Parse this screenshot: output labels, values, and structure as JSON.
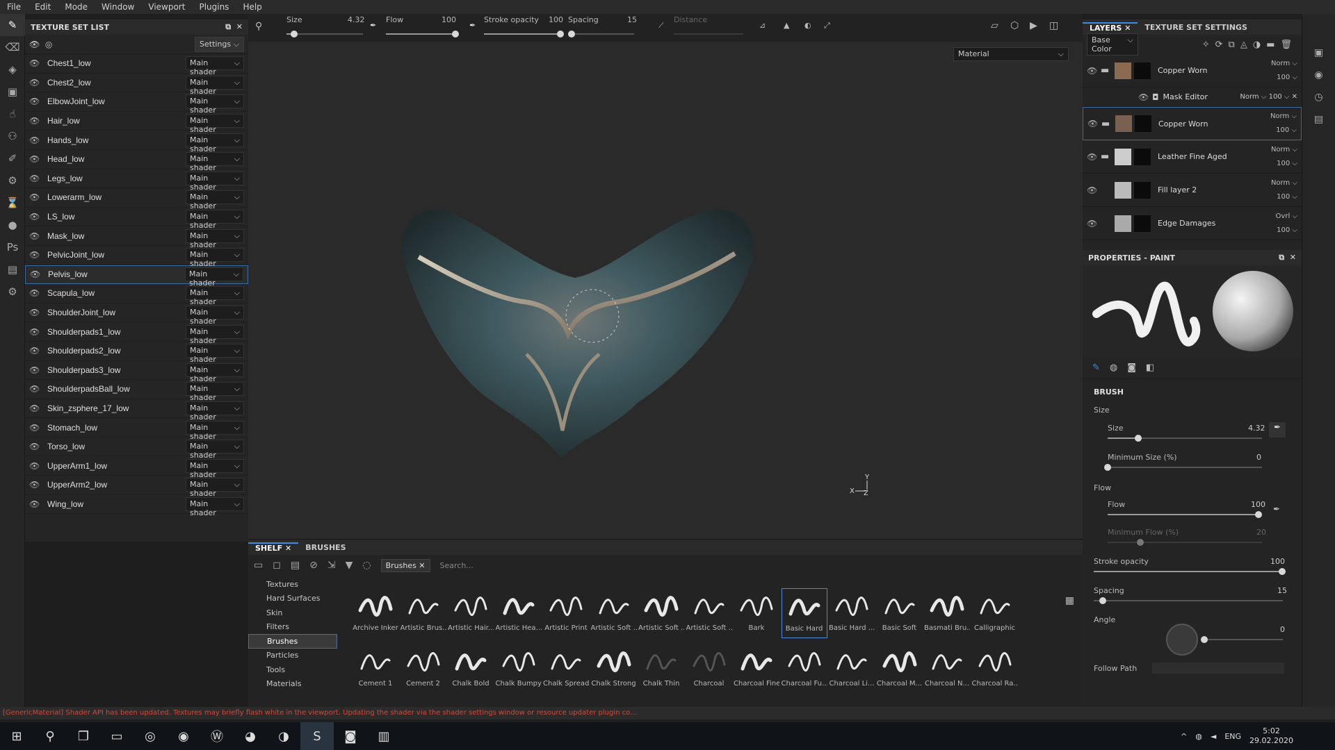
{
  "menu": [
    "File",
    "Edit",
    "Mode",
    "Window",
    "Viewport",
    "Plugins",
    "Help"
  ],
  "texture_set_list": {
    "title": "TEXTURE SET LIST",
    "settings_label": "Settings",
    "shader_label": "Main shader",
    "selected": "Pelvis_low",
    "items": [
      "Chest1_low",
      "Chest2_low",
      "ElbowJoint_low",
      "Hair_low",
      "Hands_low",
      "Head_low",
      "Legs_low",
      "Lowerarm_low",
      "LS_low",
      "Mask_low",
      "PelvicJoint_low",
      "Pelvis_low",
      "Scapula_low",
      "ShoulderJoint_low",
      "Shoulderpads1_low",
      "Shoulderpads2_low",
      "Shoulderpads3_low",
      "ShoulderpadsBall_low",
      "Skin_zsphere_17_low",
      "Stomach_low",
      "Torso_low",
      "UpperArm1_low",
      "UpperArm2_low",
      "Wing_low"
    ]
  },
  "tool_options": {
    "size_label": "Size",
    "size_value": "4.32",
    "size_pct": 0.1,
    "flow_label": "Flow",
    "flow_value": "100",
    "flow_pct": 1.0,
    "stroke_label": "Stroke opacity",
    "stroke_value": "100",
    "stroke_pct": 1.0,
    "spacing_label": "Spacing",
    "spacing_value": "15",
    "spacing_pct": 0.05,
    "distance_label": "Distance"
  },
  "viewport": {
    "material_mode": "Material"
  },
  "shelf": {
    "tabs": [
      "SHELF",
      "BRUSHES"
    ],
    "filter_chip": "Brushes",
    "search_placeholder": "Search...",
    "categories": [
      "Textures",
      "Hard Surfaces",
      "Skin",
      "Filters",
      "Brushes",
      "Particles",
      "Tools",
      "Materials"
    ],
    "selected_category": "Brushes",
    "brushes_row1": [
      "Archive Inker",
      "Artistic Brus...",
      "Artistic Hair...",
      "Artistic Hea...",
      "Artistic Print",
      "Artistic Soft ...",
      "Artistic Soft ...",
      "Artistic Soft ...",
      "Bark",
      "Basic Hard",
      "Basic Hard ...",
      "Basic Soft",
      "Basmati Bru...",
      "Calligraphic"
    ],
    "brushes_row2": [
      "Cement 1",
      "Cement 2",
      "Chalk Bold",
      "Chalk Bumpy",
      "Chalk Spread",
      "Chalk Strong",
      "Chalk Thin",
      "Charcoal",
      "Charcoal Fine",
      "Charcoal Fu...",
      "Charcoal Li...",
      "Charcoal M...",
      "Charcoal N...",
      "Charcoal Ra..."
    ],
    "selected_brush": "Basic Hard"
  },
  "layers": {
    "tabs": [
      "LAYERS",
      "TEXTURE SET SETTINGS"
    ],
    "channel": "Base Color",
    "items": [
      {
        "name": "Copper Worn",
        "blend": "Norm",
        "opacity": "100",
        "folder": true
      },
      {
        "name": "Copper Worn",
        "blend": "Norm",
        "opacity": "100",
        "folder": true,
        "selected": true
      },
      {
        "name": "Leather Fine Aged",
        "blend": "Norm",
        "opacity": "100",
        "folder": true
      },
      {
        "name": "Fill layer 2",
        "blend": "Norm",
        "opacity": "100",
        "folder": false
      },
      {
        "name": "Edge Damages",
        "blend": "Ovrl",
        "opacity": "100",
        "folder": false
      }
    ],
    "mask_editor": {
      "name": "Mask Editor",
      "blend": "Norm",
      "opacity": "100"
    }
  },
  "properties": {
    "title": "PROPERTIES - PAINT",
    "section": "BRUSH",
    "size_group": "Size",
    "size_label": "Size",
    "size_value": "4.32",
    "size_pct": 0.2,
    "min_size_label": "Minimum Size (%)",
    "min_size_value": "0",
    "flow_group": "Flow",
    "flow_label": "Flow",
    "flow_value": "100",
    "min_flow_label": "Minimum Flow (%)",
    "min_flow_value": "20",
    "stroke_label": "Stroke opacity",
    "stroke_value": "100",
    "spacing_label": "Spacing",
    "spacing_value": "15",
    "angle_label": "Angle",
    "angle_value": "0",
    "follow_path_label": "Follow Path"
  },
  "status_message": "[GenericMaterial] Shader API has been updated. Textures may briefly flash white in the viewport. Updating the shader via the shader settings window or resource updater plugin co...",
  "taskbar": {
    "lang": "ENG",
    "time": "5:02",
    "date": "29.02.2020"
  },
  "colors": {
    "accent": "#3a8ee6",
    "selection": "#3a6ea5",
    "error": "#d04a3a"
  }
}
